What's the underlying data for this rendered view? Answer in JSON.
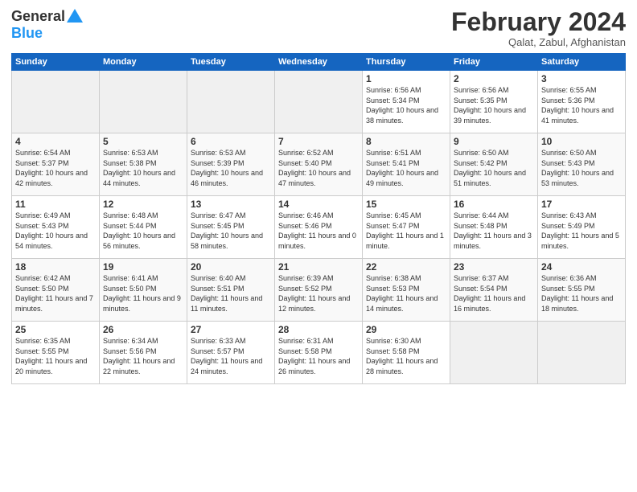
{
  "logo": {
    "general": "General",
    "blue": "Blue"
  },
  "header": {
    "month": "February 2024",
    "location": "Qalat, Zabul, Afghanistan"
  },
  "days_of_week": [
    "Sunday",
    "Monday",
    "Tuesday",
    "Wednesday",
    "Thursday",
    "Friday",
    "Saturday"
  ],
  "weeks": [
    [
      {
        "day": "",
        "empty": true
      },
      {
        "day": "",
        "empty": true
      },
      {
        "day": "",
        "empty": true
      },
      {
        "day": "",
        "empty": true
      },
      {
        "day": "1",
        "sunrise": "6:56 AM",
        "sunset": "5:34 PM",
        "daylight": "10 hours and 38 minutes."
      },
      {
        "day": "2",
        "sunrise": "6:56 AM",
        "sunset": "5:35 PM",
        "daylight": "10 hours and 39 minutes."
      },
      {
        "day": "3",
        "sunrise": "6:55 AM",
        "sunset": "5:36 PM",
        "daylight": "10 hours and 41 minutes."
      }
    ],
    [
      {
        "day": "4",
        "sunrise": "6:54 AM",
        "sunset": "5:37 PM",
        "daylight": "10 hours and 42 minutes."
      },
      {
        "day": "5",
        "sunrise": "6:53 AM",
        "sunset": "5:38 PM",
        "daylight": "10 hours and 44 minutes."
      },
      {
        "day": "6",
        "sunrise": "6:53 AM",
        "sunset": "5:39 PM",
        "daylight": "10 hours and 46 minutes."
      },
      {
        "day": "7",
        "sunrise": "6:52 AM",
        "sunset": "5:40 PM",
        "daylight": "10 hours and 47 minutes."
      },
      {
        "day": "8",
        "sunrise": "6:51 AM",
        "sunset": "5:41 PM",
        "daylight": "10 hours and 49 minutes."
      },
      {
        "day": "9",
        "sunrise": "6:50 AM",
        "sunset": "5:42 PM",
        "daylight": "10 hours and 51 minutes."
      },
      {
        "day": "10",
        "sunrise": "6:50 AM",
        "sunset": "5:43 PM",
        "daylight": "10 hours and 53 minutes."
      }
    ],
    [
      {
        "day": "11",
        "sunrise": "6:49 AM",
        "sunset": "5:43 PM",
        "daylight": "10 hours and 54 minutes."
      },
      {
        "day": "12",
        "sunrise": "6:48 AM",
        "sunset": "5:44 PM",
        "daylight": "10 hours and 56 minutes."
      },
      {
        "day": "13",
        "sunrise": "6:47 AM",
        "sunset": "5:45 PM",
        "daylight": "10 hours and 58 minutes."
      },
      {
        "day": "14",
        "sunrise": "6:46 AM",
        "sunset": "5:46 PM",
        "daylight": "11 hours and 0 minutes."
      },
      {
        "day": "15",
        "sunrise": "6:45 AM",
        "sunset": "5:47 PM",
        "daylight": "11 hours and 1 minute."
      },
      {
        "day": "16",
        "sunrise": "6:44 AM",
        "sunset": "5:48 PM",
        "daylight": "11 hours and 3 minutes."
      },
      {
        "day": "17",
        "sunrise": "6:43 AM",
        "sunset": "5:49 PM",
        "daylight": "11 hours and 5 minutes."
      }
    ],
    [
      {
        "day": "18",
        "sunrise": "6:42 AM",
        "sunset": "5:50 PM",
        "daylight": "11 hours and 7 minutes."
      },
      {
        "day": "19",
        "sunrise": "6:41 AM",
        "sunset": "5:50 PM",
        "daylight": "11 hours and 9 minutes."
      },
      {
        "day": "20",
        "sunrise": "6:40 AM",
        "sunset": "5:51 PM",
        "daylight": "11 hours and 11 minutes."
      },
      {
        "day": "21",
        "sunrise": "6:39 AM",
        "sunset": "5:52 PM",
        "daylight": "11 hours and 12 minutes."
      },
      {
        "day": "22",
        "sunrise": "6:38 AM",
        "sunset": "5:53 PM",
        "daylight": "11 hours and 14 minutes."
      },
      {
        "day": "23",
        "sunrise": "6:37 AM",
        "sunset": "5:54 PM",
        "daylight": "11 hours and 16 minutes."
      },
      {
        "day": "24",
        "sunrise": "6:36 AM",
        "sunset": "5:55 PM",
        "daylight": "11 hours and 18 minutes."
      }
    ],
    [
      {
        "day": "25",
        "sunrise": "6:35 AM",
        "sunset": "5:55 PM",
        "daylight": "11 hours and 20 minutes."
      },
      {
        "day": "26",
        "sunrise": "6:34 AM",
        "sunset": "5:56 PM",
        "daylight": "11 hours and 22 minutes."
      },
      {
        "day": "27",
        "sunrise": "6:33 AM",
        "sunset": "5:57 PM",
        "daylight": "11 hours and 24 minutes."
      },
      {
        "day": "28",
        "sunrise": "6:31 AM",
        "sunset": "5:58 PM",
        "daylight": "11 hours and 26 minutes."
      },
      {
        "day": "29",
        "sunrise": "6:30 AM",
        "sunset": "5:58 PM",
        "daylight": "11 hours and 28 minutes."
      },
      {
        "day": "",
        "empty": true
      },
      {
        "day": "",
        "empty": true
      }
    ]
  ]
}
